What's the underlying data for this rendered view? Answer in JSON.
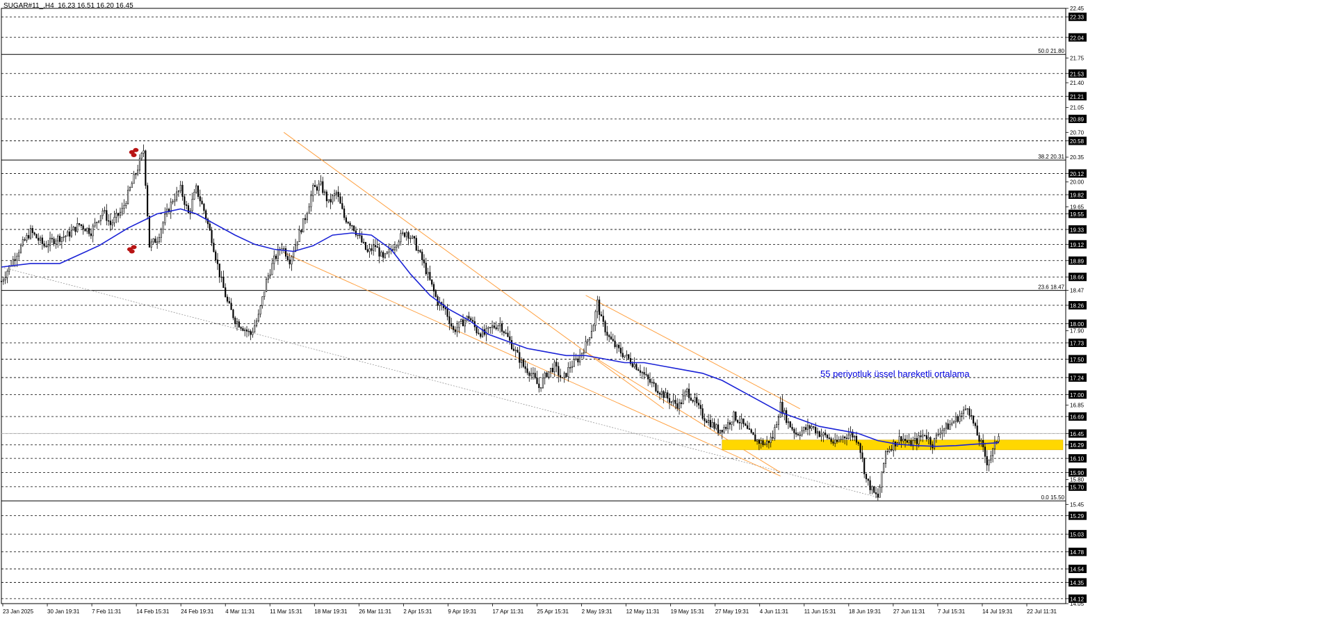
{
  "header": {
    "symbol": "SUGAR#11_,H4",
    "ohlc": "16.23 16.51 16.20 16.45"
  },
  "annotation": {
    "text": "55 periyotluk üssel hareketli ortalama",
    "color": "#0000dd"
  },
  "colors": {
    "background": "#ffffff",
    "candle": "#000000",
    "ema": "#1a22d6",
    "channel": "#ffa040",
    "zone": "#ffd700",
    "marker": "#b81414",
    "grid": "#000000"
  },
  "chart_data": {
    "type": "candlestick",
    "ylim": [
      14.05,
      22.45
    ],
    "grid": true,
    "y_tick_labels": [
      "22.45",
      "22.33",
      "22.04",
      "21.75",
      "21.53",
      "21.40",
      "21.21",
      "21.05",
      "20.89",
      "20.70",
      "20.58",
      "20.35",
      "20.12",
      "20.00",
      "19.82",
      "19.65",
      "19.55",
      "19.33",
      "19.12",
      "18.89",
      "18.66",
      "18.47",
      "18.26",
      "18.00",
      "17.90",
      "17.73",
      "17.50",
      "17.24",
      "17.00",
      "16.85",
      "16.69",
      "16.45",
      "16.29",
      "16.10",
      "15.90",
      "15.80",
      "15.70",
      "15.45",
      "15.29",
      "15.03",
      "14.78",
      "14.54",
      "14.35",
      "14.12",
      "14.05"
    ],
    "price_boxes": [
      "22.33",
      "22.04",
      "21.53",
      "21.21",
      "20.89",
      "20.58",
      "20.12",
      "19.82",
      "19.55",
      "19.33",
      "19.12",
      "18.89",
      "18.66",
      "18.26",
      "18.00",
      "17.73",
      "17.50",
      "17.24",
      "17.00",
      "16.69",
      "16.45",
      "16.29",
      "16.10",
      "15.90",
      "15.70",
      "15.29",
      "15.03",
      "14.78",
      "14.54",
      "14.35",
      "14.12"
    ],
    "x_labels": [
      "23 Jan 2025",
      "30 Jan 19:31",
      "7 Feb 11:31",
      "14 Feb 15:31",
      "24 Feb 19:31",
      "4 Mar 11:31",
      "11 Mar 15:31",
      "18 Mar 19:31",
      "26 Mar 11:31",
      "2 Apr 15:31",
      "9 Apr 19:31",
      "17 Apr 11:31",
      "25 Apr 15:31",
      "2 May 19:31",
      "12 May 11:31",
      "19 May 15:31",
      "27 May 19:31",
      "4 Jun 11:31",
      "11 Jun 15:31",
      "18 Jun 19:31",
      "27 Jun 11:31",
      "7 Jul 15:31",
      "14 Jul 19:31",
      "22 Jul 11:31"
    ],
    "fibonacci": [
      {
        "label": "50.0 21.80",
        "value": 21.8
      },
      {
        "label": "38.2 20.31",
        "value": 20.31
      },
      {
        "label": "23.6 18.47",
        "value": 18.47
      },
      {
        "label": "0.0 15.50",
        "value": 15.5
      }
    ],
    "current_price": 16.45,
    "close_path": [
      [
        0,
        18.6
      ],
      [
        8,
        19.0
      ],
      [
        15,
        19.3
      ],
      [
        22,
        19.1
      ],
      [
        28,
        19.2
      ],
      [
        34,
        19.25
      ],
      [
        40,
        19.4
      ],
      [
        46,
        19.3
      ],
      [
        52,
        19.6
      ],
      [
        56,
        19.4
      ],
      [
        62,
        19.6
      ],
      [
        66,
        19.9
      ],
      [
        70,
        20.2
      ],
      [
        73,
        20.45
      ],
      [
        76,
        19.1
      ],
      [
        80,
        19.2
      ],
      [
        84,
        19.5
      ],
      [
        88,
        19.75
      ],
      [
        92,
        19.9
      ],
      [
        96,
        19.55
      ],
      [
        100,
        19.9
      ],
      [
        104,
        19.6
      ],
      [
        108,
        19.2
      ],
      [
        112,
        18.7
      ],
      [
        116,
        18.3
      ],
      [
        120,
        18.05
      ],
      [
        124,
        17.95
      ],
      [
        128,
        17.85
      ],
      [
        132,
        18.1
      ],
      [
        136,
        18.6
      ],
      [
        140,
        18.9
      ],
      [
        144,
        19.1
      ],
      [
        148,
        18.9
      ],
      [
        152,
        19.2
      ],
      [
        156,
        19.5
      ],
      [
        160,
        19.9
      ],
      [
        164,
        19.95
      ],
      [
        168,
        19.7
      ],
      [
        172,
        19.85
      ],
      [
        176,
        19.5
      ],
      [
        180,
        19.4
      ],
      [
        184,
        19.2
      ],
      [
        188,
        19.0
      ],
      [
        192,
        19.1
      ],
      [
        196,
        18.9
      ],
      [
        200,
        19.05
      ],
      [
        204,
        19.2
      ],
      [
        208,
        19.3
      ],
      [
        212,
        19.15
      ],
      [
        216,
        18.9
      ],
      [
        220,
        18.6
      ],
      [
        224,
        18.3
      ],
      [
        228,
        18.2
      ],
      [
        232,
        17.9
      ],
      [
        236,
        18.0
      ],
      [
        240,
        18.1
      ],
      [
        244,
        17.9
      ],
      [
        248,
        17.85
      ],
      [
        252,
        17.95
      ],
      [
        256,
        18.0
      ],
      [
        260,
        17.8
      ],
      [
        264,
        17.6
      ],
      [
        268,
        17.4
      ],
      [
        272,
        17.3
      ],
      [
        276,
        17.1
      ],
      [
        280,
        17.3
      ],
      [
        284,
        17.4
      ],
      [
        288,
        17.2
      ],
      [
        292,
        17.4
      ],
      [
        296,
        17.5
      ],
      [
        300,
        17.7
      ],
      [
        304,
        18.0
      ],
      [
        306,
        18.3
      ],
      [
        308,
        18.05
      ],
      [
        312,
        17.8
      ],
      [
        316,
        17.65
      ],
      [
        320,
        17.55
      ],
      [
        324,
        17.45
      ],
      [
        328,
        17.35
      ],
      [
        332,
        17.2
      ],
      [
        336,
        17.1
      ],
      [
        340,
        17.0
      ],
      [
        344,
        16.9
      ],
      [
        348,
        16.85
      ],
      [
        352,
        17.05
      ],
      [
        356,
        16.9
      ],
      [
        360,
        16.7
      ],
      [
        364,
        16.6
      ],
      [
        368,
        16.5
      ],
      [
        372,
        16.55
      ],
      [
        376,
        16.7
      ],
      [
        380,
        16.6
      ],
      [
        384,
        16.45
      ],
      [
        388,
        16.35
      ],
      [
        392,
        16.3
      ],
      [
        396,
        16.4
      ],
      [
        400,
        16.85
      ],
      [
        404,
        16.6
      ],
      [
        408,
        16.45
      ],
      [
        412,
        16.5
      ],
      [
        416,
        16.55
      ],
      [
        420,
        16.45
      ],
      [
        424,
        16.4
      ],
      [
        428,
        16.3
      ],
      [
        432,
        16.4
      ],
      [
        436,
        16.45
      ],
      [
        440,
        16.35
      ],
      [
        444,
        15.8
      ],
      [
        448,
        15.6
      ],
      [
        450,
        15.55
      ],
      [
        452,
        15.85
      ],
      [
        454,
        16.2
      ],
      [
        458,
        16.3
      ],
      [
        462,
        16.4
      ],
      [
        466,
        16.3
      ],
      [
        470,
        16.35
      ],
      [
        474,
        16.45
      ],
      [
        478,
        16.3
      ],
      [
        482,
        16.5
      ],
      [
        486,
        16.55
      ],
      [
        490,
        16.65
      ],
      [
        494,
        16.75
      ],
      [
        496,
        16.85
      ],
      [
        500,
        16.5
      ],
      [
        503,
        16.3
      ],
      [
        506,
        16.05
      ],
      [
        509,
        16.2
      ],
      [
        512,
        16.45
      ]
    ],
    "ema_path": [
      [
        0,
        18.8
      ],
      [
        15,
        18.85
      ],
      [
        30,
        18.85
      ],
      [
        50,
        19.1
      ],
      [
        65,
        19.35
      ],
      [
        80,
        19.55
      ],
      [
        92,
        19.62
      ],
      [
        100,
        19.55
      ],
      [
        110,
        19.4
      ],
      [
        120,
        19.25
      ],
      [
        130,
        19.12
      ],
      [
        140,
        19.05
      ],
      [
        150,
        19.02
      ],
      [
        160,
        19.1
      ],
      [
        170,
        19.25
      ],
      [
        180,
        19.28
      ],
      [
        190,
        19.25
      ],
      [
        200,
        19.05
      ],
      [
        210,
        18.7
      ],
      [
        220,
        18.4
      ],
      [
        230,
        18.2
      ],
      [
        240,
        18.05
      ],
      [
        250,
        17.85
      ],
      [
        260,
        17.75
      ],
      [
        270,
        17.65
      ],
      [
        280,
        17.6
      ],
      [
        290,
        17.55
      ],
      [
        300,
        17.55
      ],
      [
        310,
        17.5
      ],
      [
        320,
        17.45
      ],
      [
        330,
        17.45
      ],
      [
        340,
        17.4
      ],
      [
        350,
        17.35
      ],
      [
        360,
        17.3
      ],
      [
        370,
        17.2
      ],
      [
        380,
        17.05
      ],
      [
        390,
        16.9
      ],
      [
        400,
        16.75
      ],
      [
        410,
        16.65
      ],
      [
        420,
        16.55
      ],
      [
        430,
        16.5
      ],
      [
        440,
        16.45
      ],
      [
        450,
        16.35
      ],
      [
        460,
        16.3
      ],
      [
        470,
        16.28
      ],
      [
        480,
        16.27
      ],
      [
        490,
        16.28
      ],
      [
        500,
        16.3
      ],
      [
        512,
        16.32
      ]
    ],
    "channel_upper": [
      [
        145,
        20.7
      ],
      [
        340,
        16.8
      ]
    ],
    "channel_lower": [
      [
        145,
        19.0
      ],
      [
        400,
        15.85
      ]
    ],
    "channel2_upper": [
      [
        300,
        18.4
      ],
      [
        410,
        16.8
      ]
    ],
    "channel2_lower": [
      [
        300,
        17.6
      ],
      [
        400,
        15.9
      ]
    ],
    "trend_dotted": [
      [
        0,
        18.8
      ],
      [
        450,
        15.55
      ]
    ],
    "zone": {
      "x0": 370,
      "x1": 545,
      "y_top": 16.36,
      "y_bottom": 16.22
    },
    "markers": [
      [
        67,
        20.42
      ],
      [
        68,
        20.38
      ],
      [
        69,
        20.45
      ],
      [
        66,
        19.05
      ],
      [
        67,
        19.02
      ],
      [
        68,
        19.08
      ]
    ]
  }
}
